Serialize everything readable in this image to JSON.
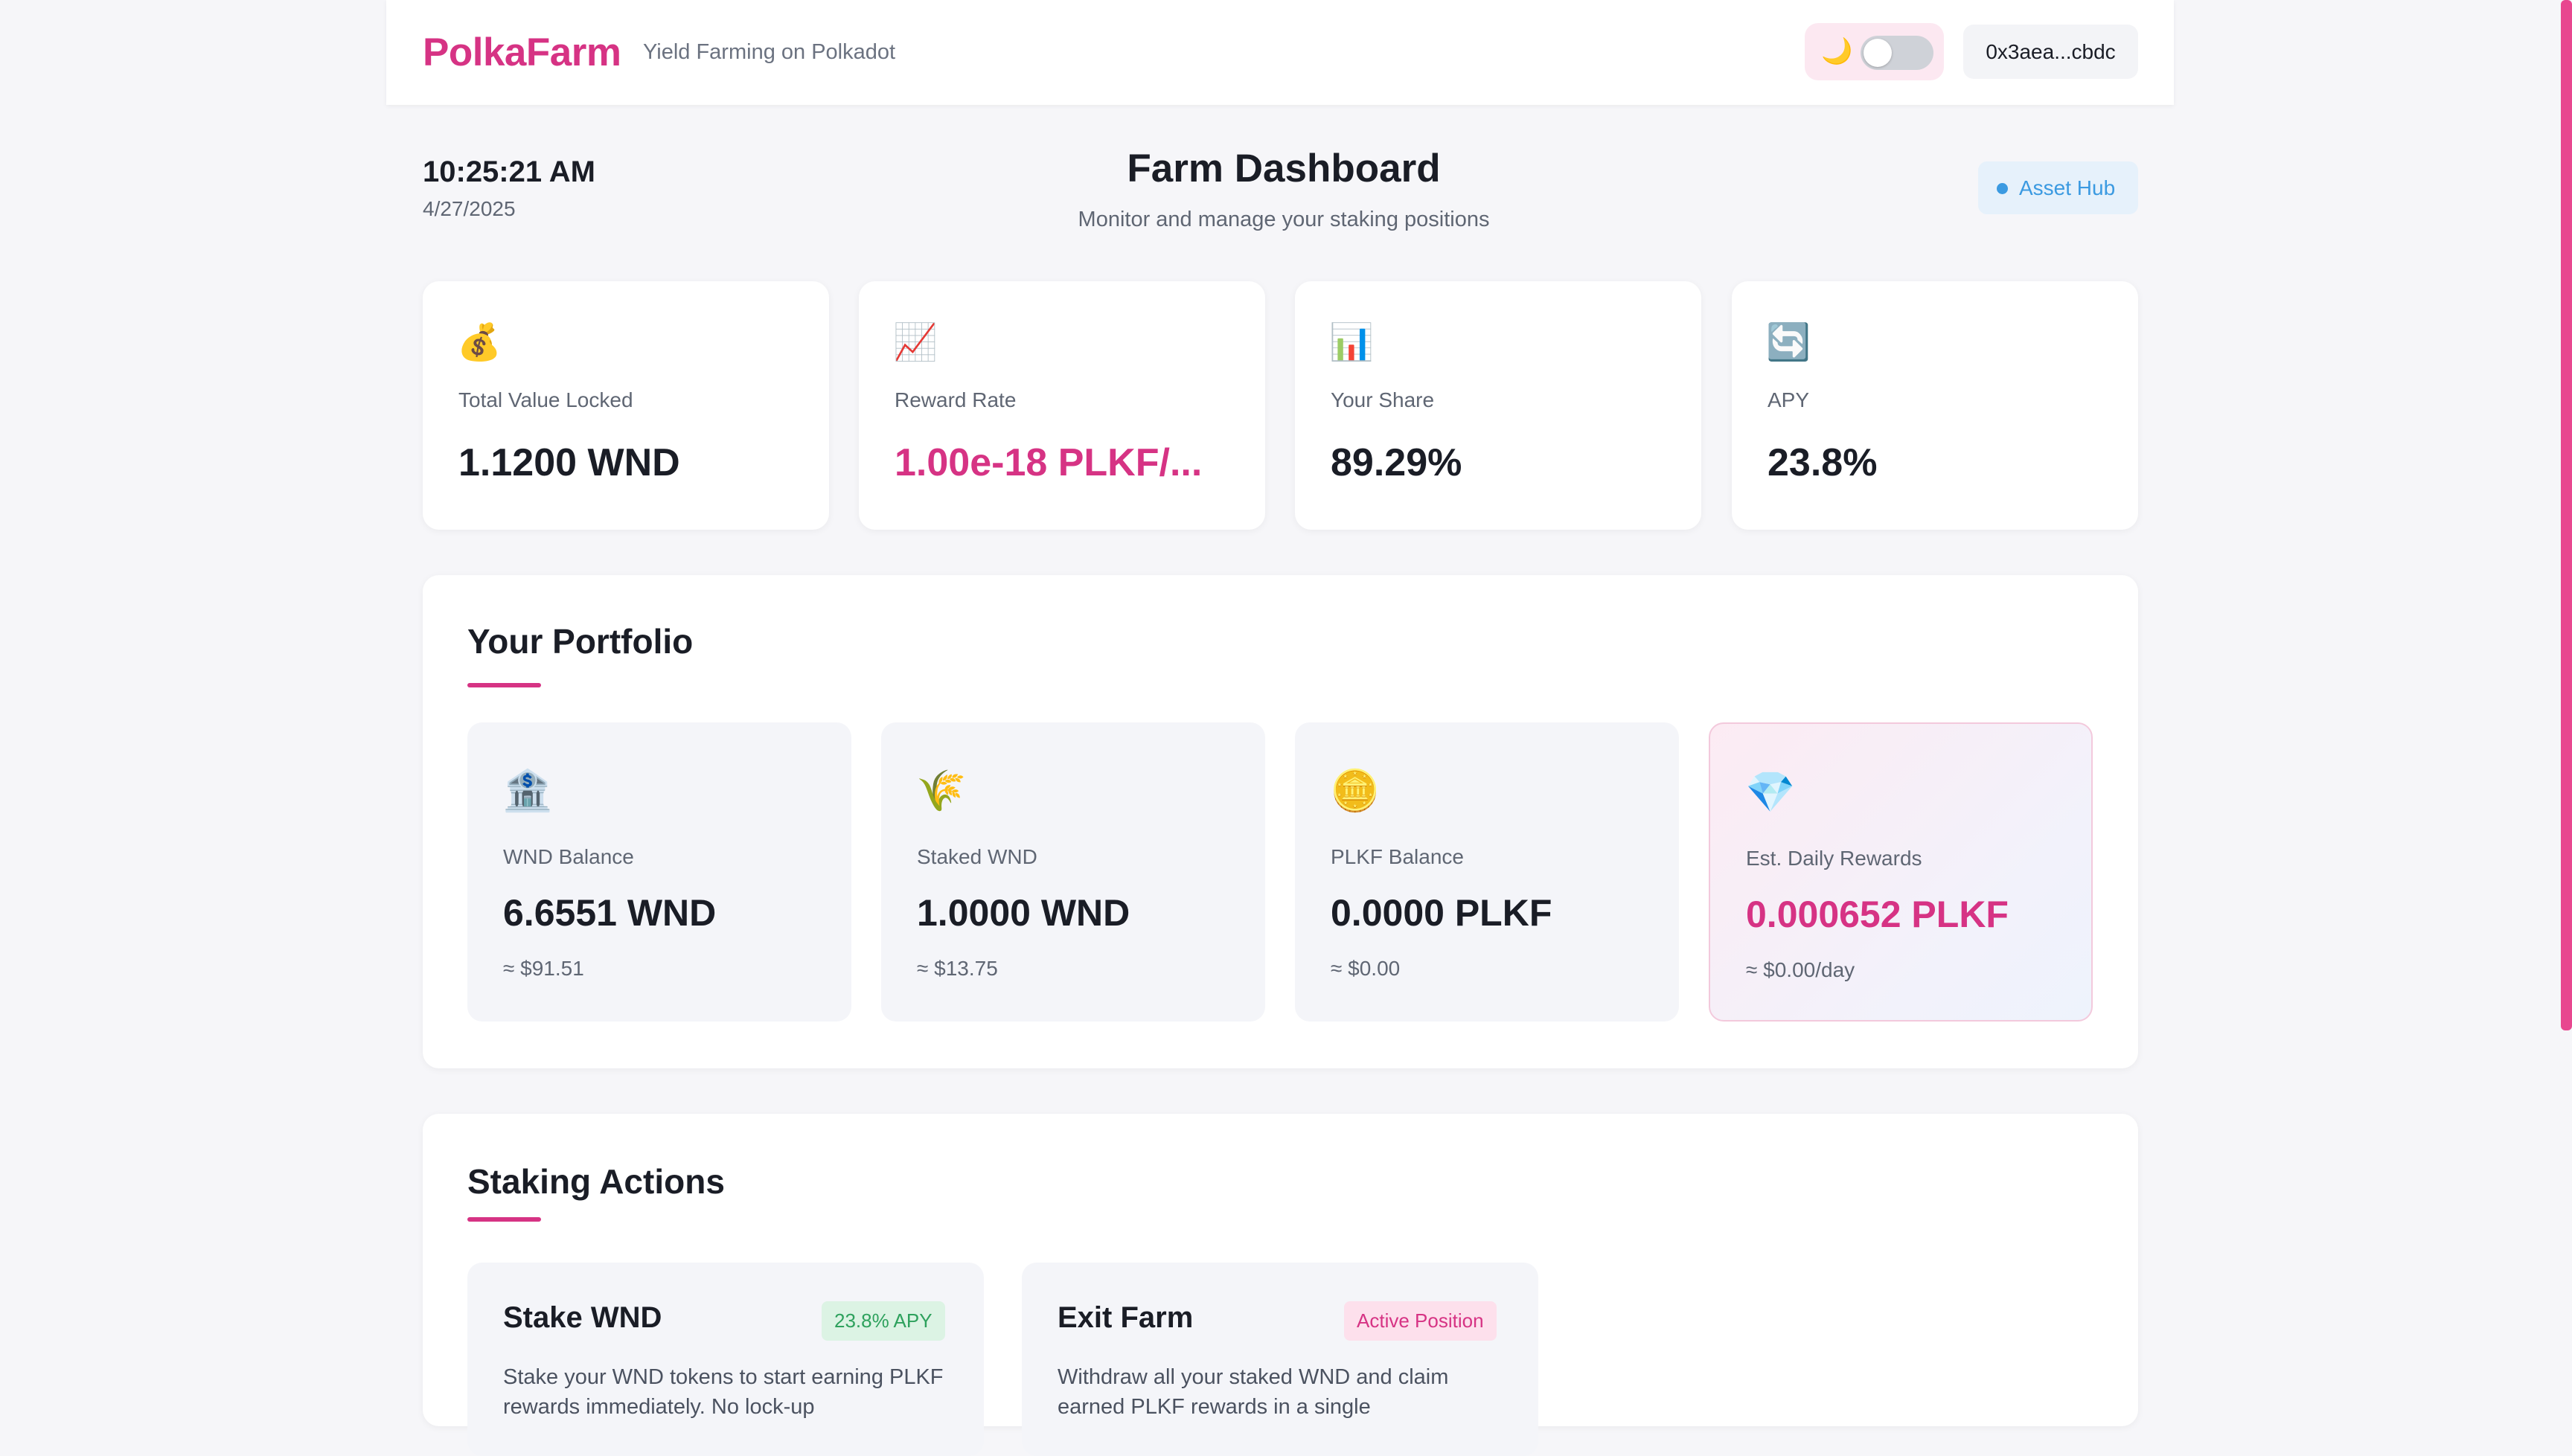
{
  "header": {
    "brand": "PolkaFarm",
    "tagline": "Yield Farming on Polkadot",
    "theme_icon": "🌙",
    "wallet": "0x3aea...cbdc"
  },
  "clock": {
    "time": "10:25:21 AM",
    "date": "4/27/2025"
  },
  "dashboard": {
    "title": "Farm Dashboard",
    "subtitle": "Monitor and manage your staking positions",
    "network": "Asset Hub"
  },
  "stats": [
    {
      "icon": "💰",
      "icon_name": "money-bag-icon",
      "label": "Total Value Locked",
      "value": "1.1200 WND"
    },
    {
      "icon": "📈",
      "icon_name": "chart-up-icon",
      "label": "Reward Rate",
      "value": "1.00e-18 PLKF/..."
    },
    {
      "icon": "📊",
      "icon_name": "bar-chart-icon",
      "label": "Your Share",
      "value": "89.29%"
    },
    {
      "icon": "🔄",
      "icon_name": "refresh-icon",
      "label": "APY",
      "value": "23.8%"
    }
  ],
  "portfolio": {
    "title": "Your Portfolio",
    "cards": [
      {
        "icon": "🏦",
        "icon_name": "bank-icon",
        "label": "WND Balance",
        "value": "6.6551 WND",
        "sub": "≈ $91.51"
      },
      {
        "icon": "🌾",
        "icon_name": "wheat-icon",
        "label": "Staked WND",
        "value": "1.0000 WND",
        "sub": "≈ $13.75"
      },
      {
        "icon": "🪙",
        "icon_name": "coin-icon",
        "label": "PLKF Balance",
        "value": "0.0000 PLKF",
        "sub": "≈ $0.00"
      },
      {
        "icon": "💎",
        "icon_name": "gem-icon",
        "label": "Est. Daily Rewards",
        "value": "0.000652 PLKF",
        "sub": "≈ $0.00/day"
      }
    ]
  },
  "actions": {
    "title": "Staking Actions",
    "stake": {
      "title": "Stake WND",
      "badge": "23.8% APY",
      "desc": "Stake your WND tokens to start earning PLKF rewards immediately. No lock-up"
    },
    "exit": {
      "title": "Exit Farm",
      "badge": "Active Position",
      "desc": "Withdraw all your staked WND and claim earned PLKF rewards in a single"
    }
  },
  "colors": {
    "accent": "#d63384",
    "network_blue": "#3b9ae1",
    "apy_green": "#2ea15d",
    "background": "#f6f6f9"
  }
}
